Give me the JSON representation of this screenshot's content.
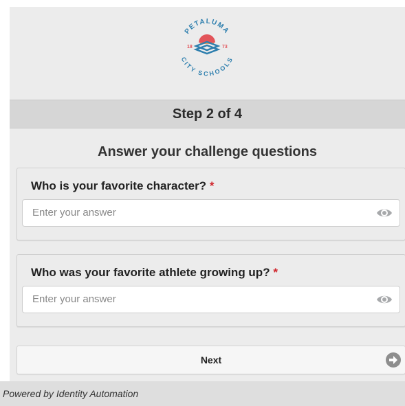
{
  "logo": {
    "arc_top": "PETALUMA",
    "arc_bottom": "CITY SCHOOLS",
    "year_left": "18",
    "year_right": "73"
  },
  "step": {
    "label": "Step 2 of 4"
  },
  "heading": "Answer your challenge questions",
  "questions": [
    {
      "label": "Who is your favorite character?",
      "required_mark": "*",
      "placeholder": "Enter your answer",
      "value": ""
    },
    {
      "label": "Who was your favorite athlete growing up?",
      "required_mark": "*",
      "placeholder": "Enter your answer",
      "value": ""
    }
  ],
  "next_button": {
    "label": "Next",
    "icon": "arrow-right-circle-icon"
  },
  "footer": {
    "text": "Powered by Identity Automation"
  },
  "colors": {
    "background": "#ececec",
    "step_bar": "#d6d6d6",
    "required": "#d0262c",
    "logo_blue": "#2e7fae",
    "logo_red": "#e2545a",
    "logo_orange": "#f29a54"
  }
}
